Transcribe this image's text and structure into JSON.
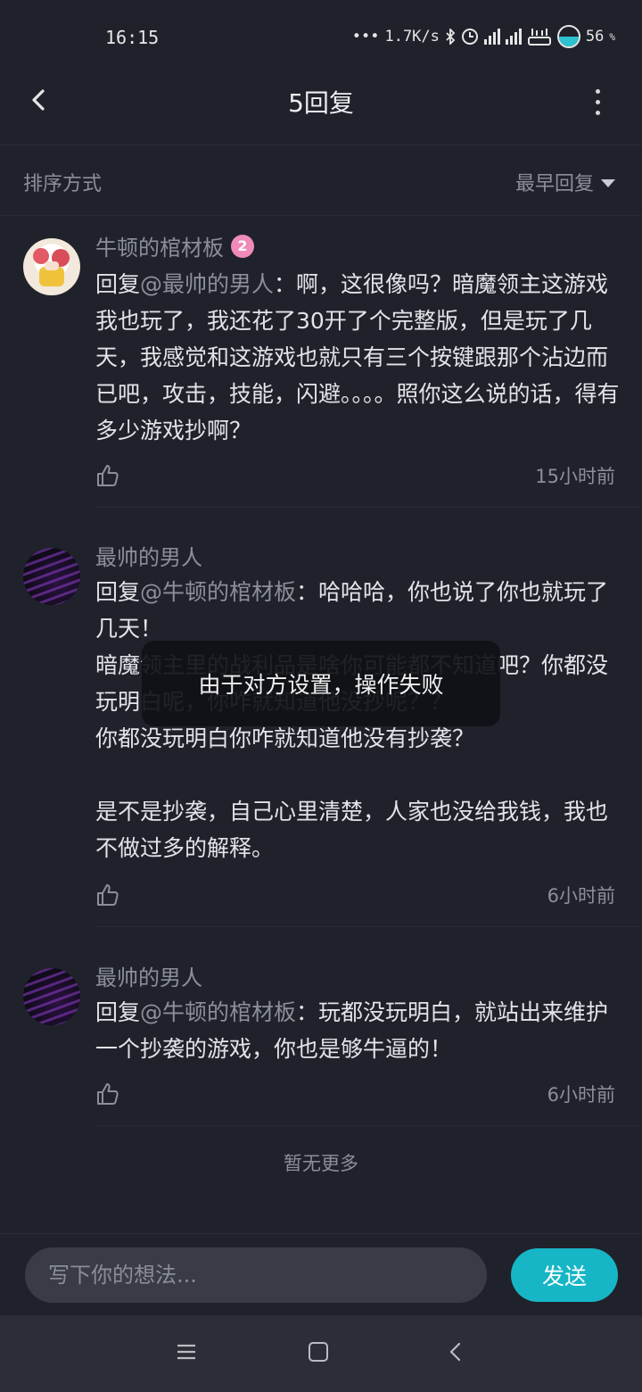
{
  "status_bar": {
    "time": "16:15",
    "network_speed": "1.7K/s",
    "battery_level": "56",
    "battery_unit": "%",
    "icons": [
      "more-dots-icon",
      "bluetooth-icon",
      "alarm-icon",
      "signal-icon",
      "signal-icon",
      "wifi-icon",
      "battery-icon"
    ]
  },
  "header": {
    "title": "5回复",
    "back_icon": "chevron-left-icon",
    "more_icon": "more-vertical-icon"
  },
  "sort": {
    "label": "排序方式",
    "selected": "最早回复"
  },
  "comments": [
    {
      "username": "牛顿的棺材板",
      "level": "2",
      "reply_prefix": "回复",
      "mention": "@最帅的男人",
      "body": "：啊，这很像吗？暗魔领主这游戏我也玩了，我还花了30开了个完整版，但是玩了几天，我感觉和这游戏也就只有三个按键跟那个沾边而已吧，攻击，技能，闪避。。。。照你这么说的话，得有多少游戏抄啊？",
      "time": "15小时前"
    },
    {
      "username": "最帅的男人",
      "reply_prefix": "回复",
      "mention": "@牛顿的棺材板",
      "body": "：哈哈哈，你也说了你也就玩了几天！\n暗魔领主里的战利品是啥你可能都不知道吧？你都没玩明白呢，你咋就知道他没抄呢？？\n你都没玩明白你咋就知道他没有抄袭？\n\n是不是抄袭，自己心里清楚，人家也没给我钱，我也不做过多的解释。",
      "time": "6小时前"
    },
    {
      "username": "最帅的男人",
      "reply_prefix": "回复",
      "mention": "@牛顿的棺材板",
      "body": "：玩都没玩明白，就站出来维护一个抄袭的游戏，你也是够牛逼的！",
      "time": "6小时前"
    }
  ],
  "no_more": "暂无更多",
  "toast": "由于对方设置，操作失败",
  "input": {
    "placeholder": "写下你的想法...",
    "send_label": "发送"
  },
  "colors": {
    "background": "#20222b",
    "accent": "#16b6c6",
    "muted_text": "#8c8f98",
    "badge": "#f08ab8"
  }
}
